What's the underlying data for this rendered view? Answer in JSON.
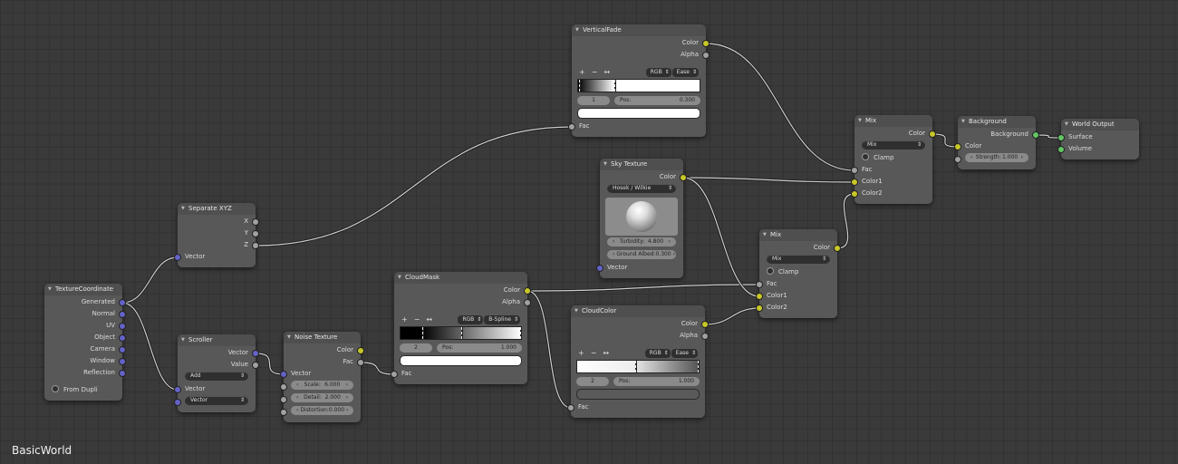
{
  "editor_title": "BasicWorld",
  "colors": {
    "color_socket": "#c7c729",
    "value_socket": "#a1a1a1",
    "vector_socket": "#6363c7",
    "shader_socket": "#63c763"
  },
  "nodes": [
    {
      "id": "texture_coordinate",
      "title": "TextureCoordinate",
      "rows": [
        {
          "type": "out",
          "label": "Generated",
          "socket": "vector"
        },
        {
          "type": "out",
          "label": "Normal",
          "socket": "vector"
        },
        {
          "type": "out",
          "label": "UV",
          "socket": "vector"
        },
        {
          "type": "out",
          "label": "Object",
          "socket": "vector"
        },
        {
          "type": "out",
          "label": "Camera",
          "socket": "vector"
        },
        {
          "type": "out",
          "label": "Window",
          "socket": "vector"
        },
        {
          "type": "out",
          "label": "Reflection",
          "socket": "vector"
        },
        {
          "type": "spacer"
        },
        {
          "type": "checkbox",
          "label": "From Dupli"
        }
      ]
    },
    {
      "id": "separate_xyz",
      "title": "Separate XYZ",
      "rows": [
        {
          "type": "out",
          "label": "X",
          "socket": "value"
        },
        {
          "type": "out",
          "label": "Y",
          "socket": "value"
        },
        {
          "type": "out",
          "label": "Z",
          "socket": "value"
        },
        {
          "type": "in",
          "label": "Vector",
          "socket": "vector"
        }
      ]
    },
    {
      "id": "scroller",
      "title": "Scroller",
      "rows": [
        {
          "type": "out",
          "label": "Vector",
          "socket": "vector"
        },
        {
          "type": "out",
          "label": "Value",
          "socket": "value"
        },
        {
          "type": "dropdown",
          "label": "Add"
        },
        {
          "type": "in",
          "label": "Vector",
          "socket": "vector"
        },
        {
          "type": "dropdown",
          "label": "Vector",
          "socket": "vector"
        }
      ]
    },
    {
      "id": "noise_texture",
      "title": "Noise Texture",
      "rows": [
        {
          "type": "out",
          "label": "Color",
          "socket": "color"
        },
        {
          "type": "out",
          "label": "Fac",
          "socket": "value"
        },
        {
          "type": "in",
          "label": "Vector",
          "socket": "vector"
        },
        {
          "type": "field",
          "label": "Scale:",
          "value": "6.000",
          "socket": "value"
        },
        {
          "type": "field",
          "label": "Detail:",
          "value": "2.000",
          "socket": "value"
        },
        {
          "type": "field",
          "label": "Distortion:",
          "value": "0.000",
          "socket": "value"
        }
      ]
    },
    {
      "id": "cloud_mask",
      "title": "CloudMask",
      "rows": [
        {
          "type": "out",
          "label": "Color",
          "socket": "color"
        },
        {
          "type": "out",
          "label": "Alpha",
          "socket": "value"
        },
        {
          "type": "spacer"
        },
        {
          "type": "toolbar",
          "color_mode": "RGB",
          "interpolation": "B-Spline"
        },
        {
          "type": "gradient",
          "gradient": "linear-gradient(90deg,#000 0%,#000 18%,#fff 100%)",
          "marks": [
            18,
            50,
            99
          ]
        },
        {
          "type": "pos",
          "index": "2",
          "pos_label": "Pos:",
          "pos_value": "1.000"
        },
        {
          "type": "swatch",
          "color": "#ffffff"
        },
        {
          "type": "in",
          "label": "Fac",
          "socket": "value"
        }
      ]
    },
    {
      "id": "vertical_fade",
      "title": "VerticalFade",
      "rows": [
        {
          "type": "out",
          "label": "Color",
          "socket": "color"
        },
        {
          "type": "out",
          "label": "Alpha",
          "socket": "value"
        },
        {
          "type": "spacer"
        },
        {
          "type": "toolbar",
          "color_mode": "RGB",
          "interpolation": "Ease"
        },
        {
          "type": "gradient",
          "gradient": "linear-gradient(90deg,#000 0%,#fff 30%,#fff 100%)",
          "marks": [
            1,
            30
          ]
        },
        {
          "type": "pos",
          "index": "1",
          "pos_label": "Pos:",
          "pos_value": "0.300"
        },
        {
          "type": "swatch",
          "color": "#ffffff"
        },
        {
          "type": "in",
          "label": "Fac",
          "socket": "value"
        }
      ]
    },
    {
      "id": "sky_texture",
      "title": "Sky Texture",
      "rows": [
        {
          "type": "out",
          "label": "Color",
          "socket": "color"
        },
        {
          "type": "dropdown",
          "label": "Hosek / Wilkie"
        },
        {
          "type": "preview"
        },
        {
          "type": "field",
          "label": "Turbidity:",
          "value": "4.800"
        },
        {
          "type": "field",
          "label": "Ground Albed:",
          "value": "0.300"
        },
        {
          "type": "in",
          "label": "Vector",
          "socket": "vector"
        }
      ]
    },
    {
      "id": "cloud_color",
      "title": "CloudColor",
      "rows": [
        {
          "type": "out",
          "label": "Color",
          "socket": "color"
        },
        {
          "type": "out",
          "label": "Alpha",
          "socket": "value"
        },
        {
          "type": "spacer"
        },
        {
          "type": "toolbar",
          "color_mode": "RGB",
          "interpolation": "Ease"
        },
        {
          "type": "gradient",
          "gradient": "linear-gradient(90deg,#fff 0%,#eee 45%,#555 100%)",
          "marks": [
            48,
            99
          ]
        },
        {
          "type": "pos",
          "index": "2",
          "pos_label": "Pos:",
          "pos_value": "1.000"
        },
        {
          "type": "swatch",
          "color": "#5a5a5a"
        },
        {
          "type": "in",
          "label": "Fac",
          "socket": "value"
        }
      ]
    },
    {
      "id": "mix2",
      "title": "Mix",
      "rows": [
        {
          "type": "out",
          "label": "Color",
          "socket": "color"
        },
        {
          "type": "dropdown",
          "label": "Mix"
        },
        {
          "type": "checkbox",
          "label": "Clamp"
        },
        {
          "type": "in",
          "label": "Fac",
          "socket": "value"
        },
        {
          "type": "in",
          "label": "Color1",
          "socket": "color"
        },
        {
          "type": "in",
          "label": "Color2",
          "socket": "color"
        }
      ]
    },
    {
      "id": "mix1",
      "title": "Mix",
      "rows": [
        {
          "type": "out",
          "label": "Color",
          "socket": "color"
        },
        {
          "type": "dropdown",
          "label": "Mix"
        },
        {
          "type": "checkbox",
          "label": "Clamp"
        },
        {
          "type": "in",
          "label": "Fac",
          "socket": "value"
        },
        {
          "type": "in",
          "label": "Color1",
          "socket": "color"
        },
        {
          "type": "in",
          "label": "Color2",
          "socket": "color"
        }
      ]
    },
    {
      "id": "background",
      "title": "Background",
      "rows": [
        {
          "type": "out",
          "label": "Background",
          "socket": "shader"
        },
        {
          "type": "in",
          "label": "Color",
          "socket": "color"
        },
        {
          "type": "field",
          "label": "Strength:",
          "value": "1.000",
          "socket": "value"
        }
      ]
    },
    {
      "id": "world_output",
      "title": "World Output",
      "rows": [
        {
          "type": "in",
          "label": "Surface",
          "socket": "shader"
        },
        {
          "type": "in",
          "label": "Volume",
          "socket": "shader"
        }
      ]
    }
  ],
  "links": [
    {
      "from": [
        "texture_coordinate",
        0
      ],
      "to": [
        "separate_xyz",
        3
      ]
    },
    {
      "from": [
        "texture_coordinate",
        0
      ],
      "to": [
        "scroller",
        3
      ]
    },
    {
      "from": [
        "separate_xyz",
        2
      ],
      "to": [
        "vertical_fade",
        7
      ]
    },
    {
      "from": [
        "scroller",
        0
      ],
      "to": [
        "noise_texture",
        2
      ]
    },
    {
      "from": [
        "noise_texture",
        1
      ],
      "to": [
        "cloud_mask",
        7
      ]
    },
    {
      "from": [
        "cloud_mask",
        0
      ],
      "to": [
        "mix2",
        3
      ]
    },
    {
      "from": [
        "cloud_mask",
        0
      ],
      "to": [
        "cloud_color",
        7
      ]
    },
    {
      "from": [
        "sky_texture",
        0
      ],
      "to": [
        "mix1",
        4
      ]
    },
    {
      "from": [
        "sky_texture",
        0
      ],
      "to": [
        "mix2",
        4
      ]
    },
    {
      "from": [
        "cloud_color",
        0
      ],
      "to": [
        "mix2",
        5
      ]
    },
    {
      "from": [
        "vertical_fade",
        0
      ],
      "to": [
        "mix1",
        3
      ]
    },
    {
      "from": [
        "mix2",
        0
      ],
      "to": [
        "mix1",
        5
      ]
    },
    {
      "from": [
        "mix1",
        0
      ],
      "to": [
        "background",
        1
      ]
    },
    {
      "from": [
        "background",
        0
      ],
      "to": [
        "world_output",
        0
      ]
    }
  ]
}
